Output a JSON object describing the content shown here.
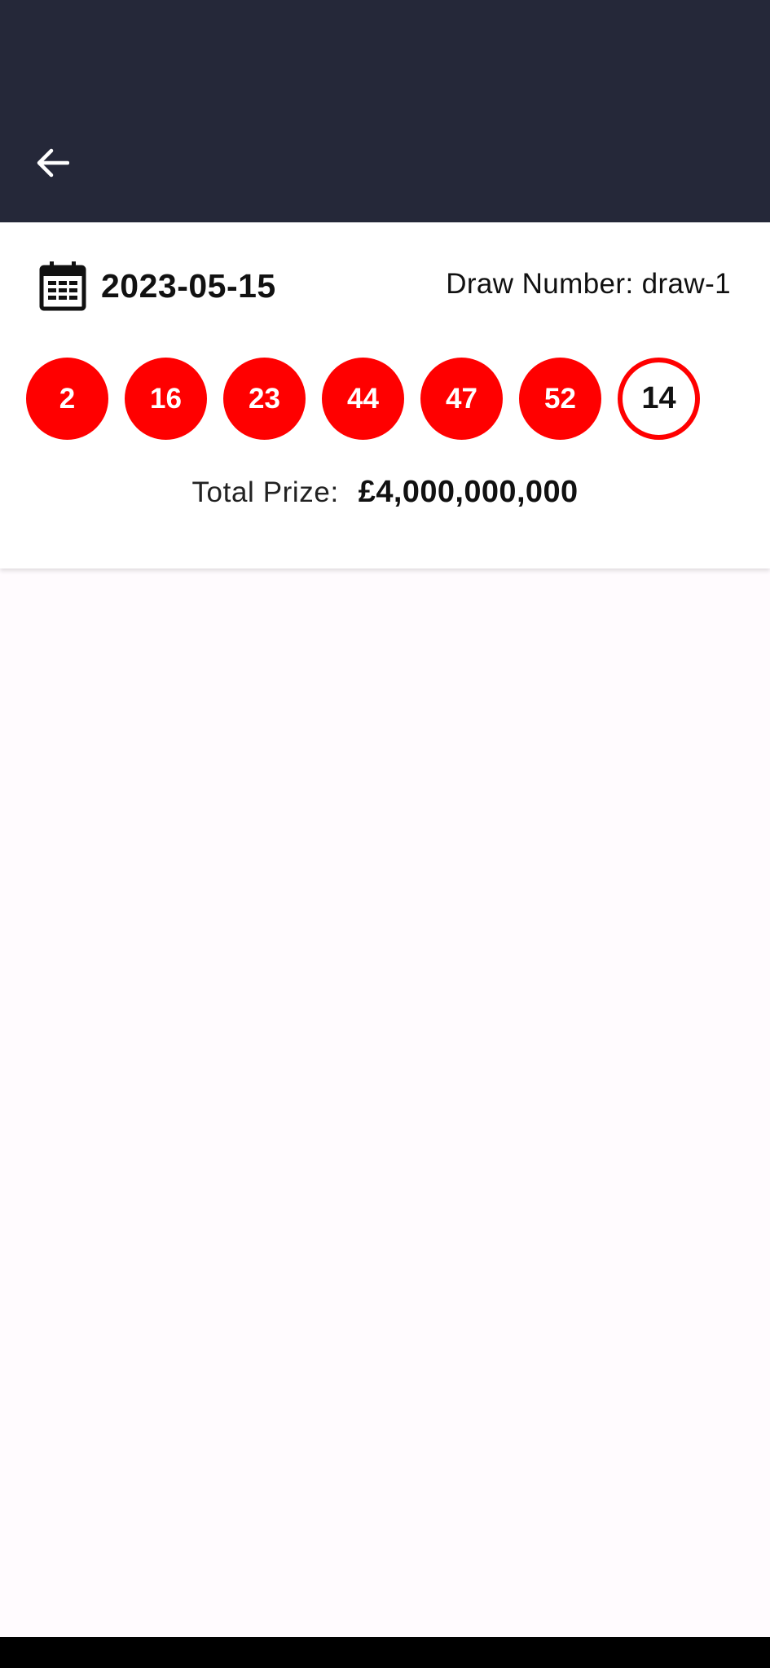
{
  "app_bar": {
    "background": "#252839",
    "back_icon": "arrow-left-icon"
  },
  "draw": {
    "date_icon": "calendar-icon",
    "date": "2023-05-15",
    "draw_number_label": "Draw Number:",
    "draw_number_value": "draw-1",
    "balls": [
      "2",
      "16",
      "23",
      "44",
      "47",
      "52"
    ],
    "bonus_ball": "14",
    "ball_color": "#ff0000",
    "prize_label": "Total Prize:",
    "prize_value": "£4,000,000,000"
  }
}
